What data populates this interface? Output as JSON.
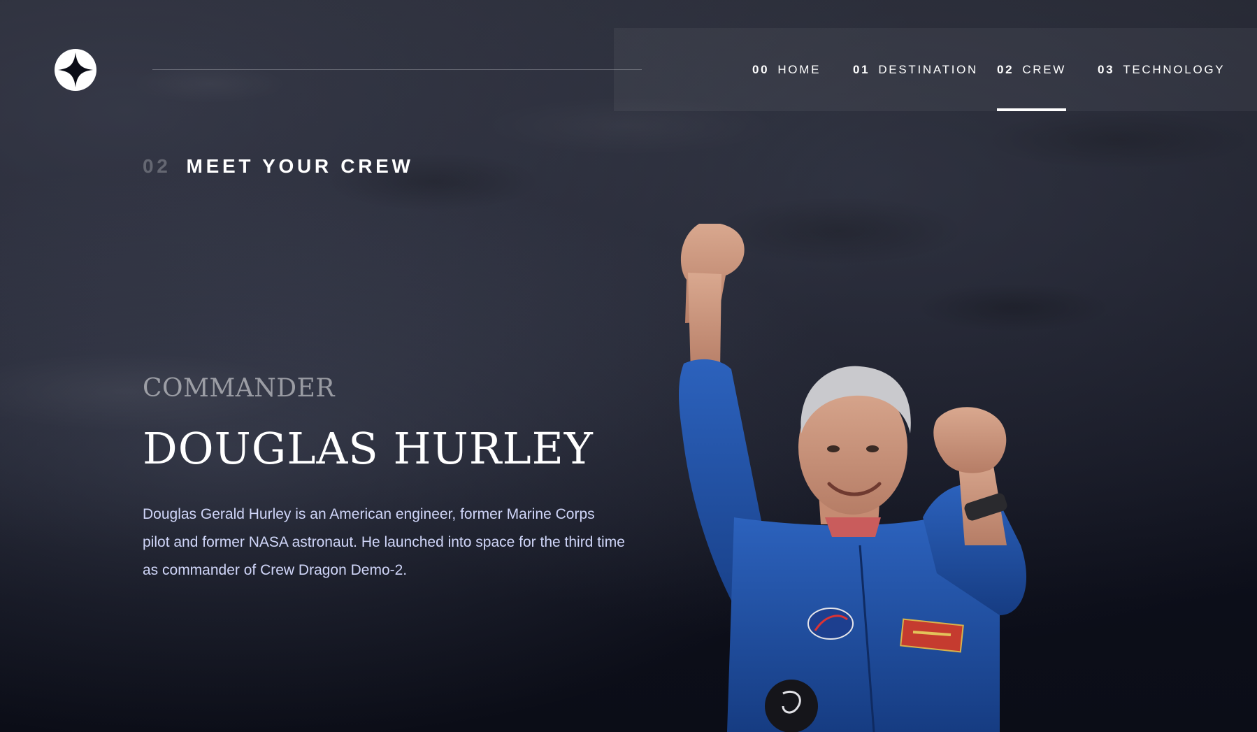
{
  "brand": {
    "logo_icon": "star-logo-icon"
  },
  "nav": {
    "items": [
      {
        "num": "00",
        "label": "HOME",
        "active": false
      },
      {
        "num": "01",
        "label": "DESTINATION",
        "active": false
      },
      {
        "num": "02",
        "label": "CREW",
        "active": true
      },
      {
        "num": "03",
        "label": "TECHNOLOGY",
        "active": false
      }
    ]
  },
  "heading": {
    "num": "02",
    "title": "MEET YOUR CREW"
  },
  "crew": {
    "role": "COMMANDER",
    "name": "DOUGLAS HURLEY",
    "bio": "Douglas Gerald Hurley is an American engineer, former Marine Corps pilot and former NASA astronaut. He launched into space for the third time as commander of Crew Dragon Demo-2.",
    "image_icon": "astronaut-portrait"
  },
  "colors": {
    "background": "#0b0d17",
    "text": "#ffffff",
    "body_text": "#d0d6f9",
    "suit": "#1f4fa0"
  }
}
